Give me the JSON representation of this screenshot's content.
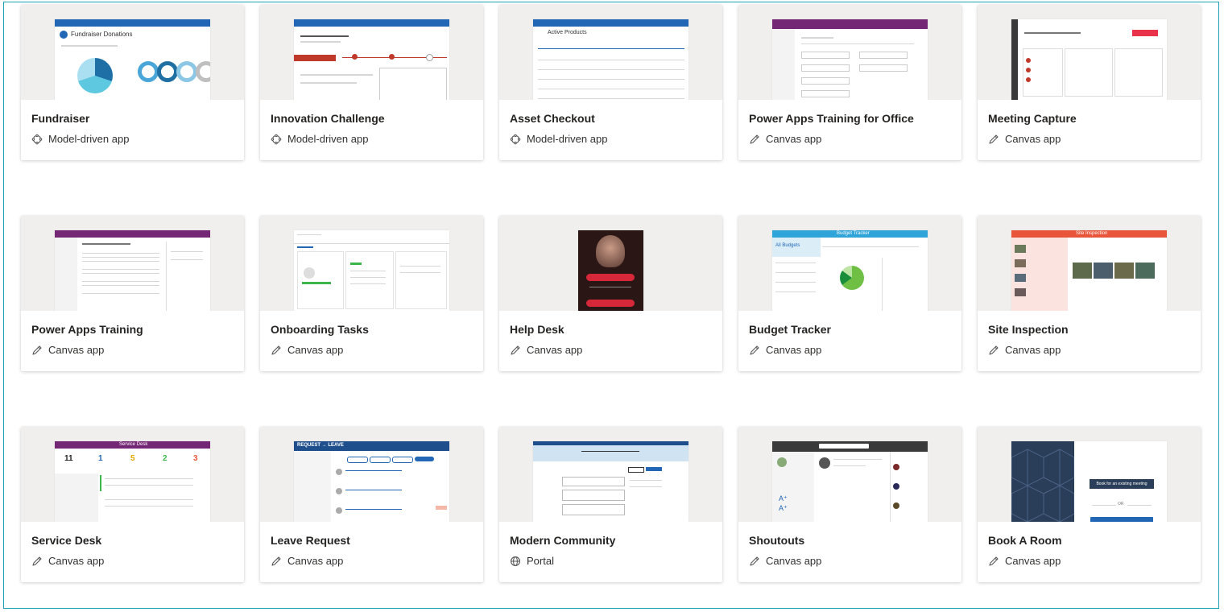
{
  "cards": [
    {
      "title": "Fundraiser",
      "type": "Model-driven app",
      "type_icon": "model-driven-icon"
    },
    {
      "title": "Innovation Challenge",
      "type": "Model-driven app",
      "type_icon": "model-driven-icon"
    },
    {
      "title": "Asset Checkout",
      "type": "Model-driven app",
      "type_icon": "model-driven-icon"
    },
    {
      "title": "Power Apps Training for Office",
      "type": "Canvas app",
      "type_icon": "pencil-icon"
    },
    {
      "title": "Meeting Capture",
      "type": "Canvas app",
      "type_icon": "pencil-icon"
    },
    {
      "title": "Power Apps Training",
      "type": "Canvas app",
      "type_icon": "pencil-icon"
    },
    {
      "title": "Onboarding Tasks",
      "type": "Canvas app",
      "type_icon": "pencil-icon"
    },
    {
      "title": "Help Desk",
      "type": "Canvas app",
      "type_icon": "pencil-icon"
    },
    {
      "title": "Budget Tracker",
      "type": "Canvas app",
      "type_icon": "pencil-icon"
    },
    {
      "title": "Site Inspection",
      "type": "Canvas app",
      "type_icon": "pencil-icon"
    },
    {
      "title": "Service Desk",
      "type": "Canvas app",
      "type_icon": "pencil-icon"
    },
    {
      "title": "Leave Request",
      "type": "Canvas app",
      "type_icon": "pencil-icon"
    },
    {
      "title": "Modern Community",
      "type": "Portal",
      "type_icon": "globe-icon"
    },
    {
      "title": "Shoutouts",
      "type": "Canvas app",
      "type_icon": "pencil-icon"
    },
    {
      "title": "Book A Room",
      "type": "Canvas app",
      "type_icon": "pencil-icon"
    }
  ],
  "thumbnails": {
    "fundraiser_heading": "Fundraiser Donations",
    "asset_heading": "Active Products",
    "site_heading": "Site Inspection",
    "service_heading": "Service Desk",
    "service_counts": [
      "11",
      "1",
      "5",
      "2",
      "3"
    ],
    "leave_heading": "REQUEST → LEAVE",
    "budget_heading": "Budget Tracker",
    "budget_all": "All Budgets",
    "room_button": "Book for an existing meeting",
    "room_or": "OR"
  },
  "colors": {
    "dynamics_blue": "#2266b6",
    "purple": "#742774",
    "teal": "#2fa4d8",
    "red": "#d73b3e",
    "navy": "#2a3e5a",
    "dark": "#3a3a3a"
  }
}
